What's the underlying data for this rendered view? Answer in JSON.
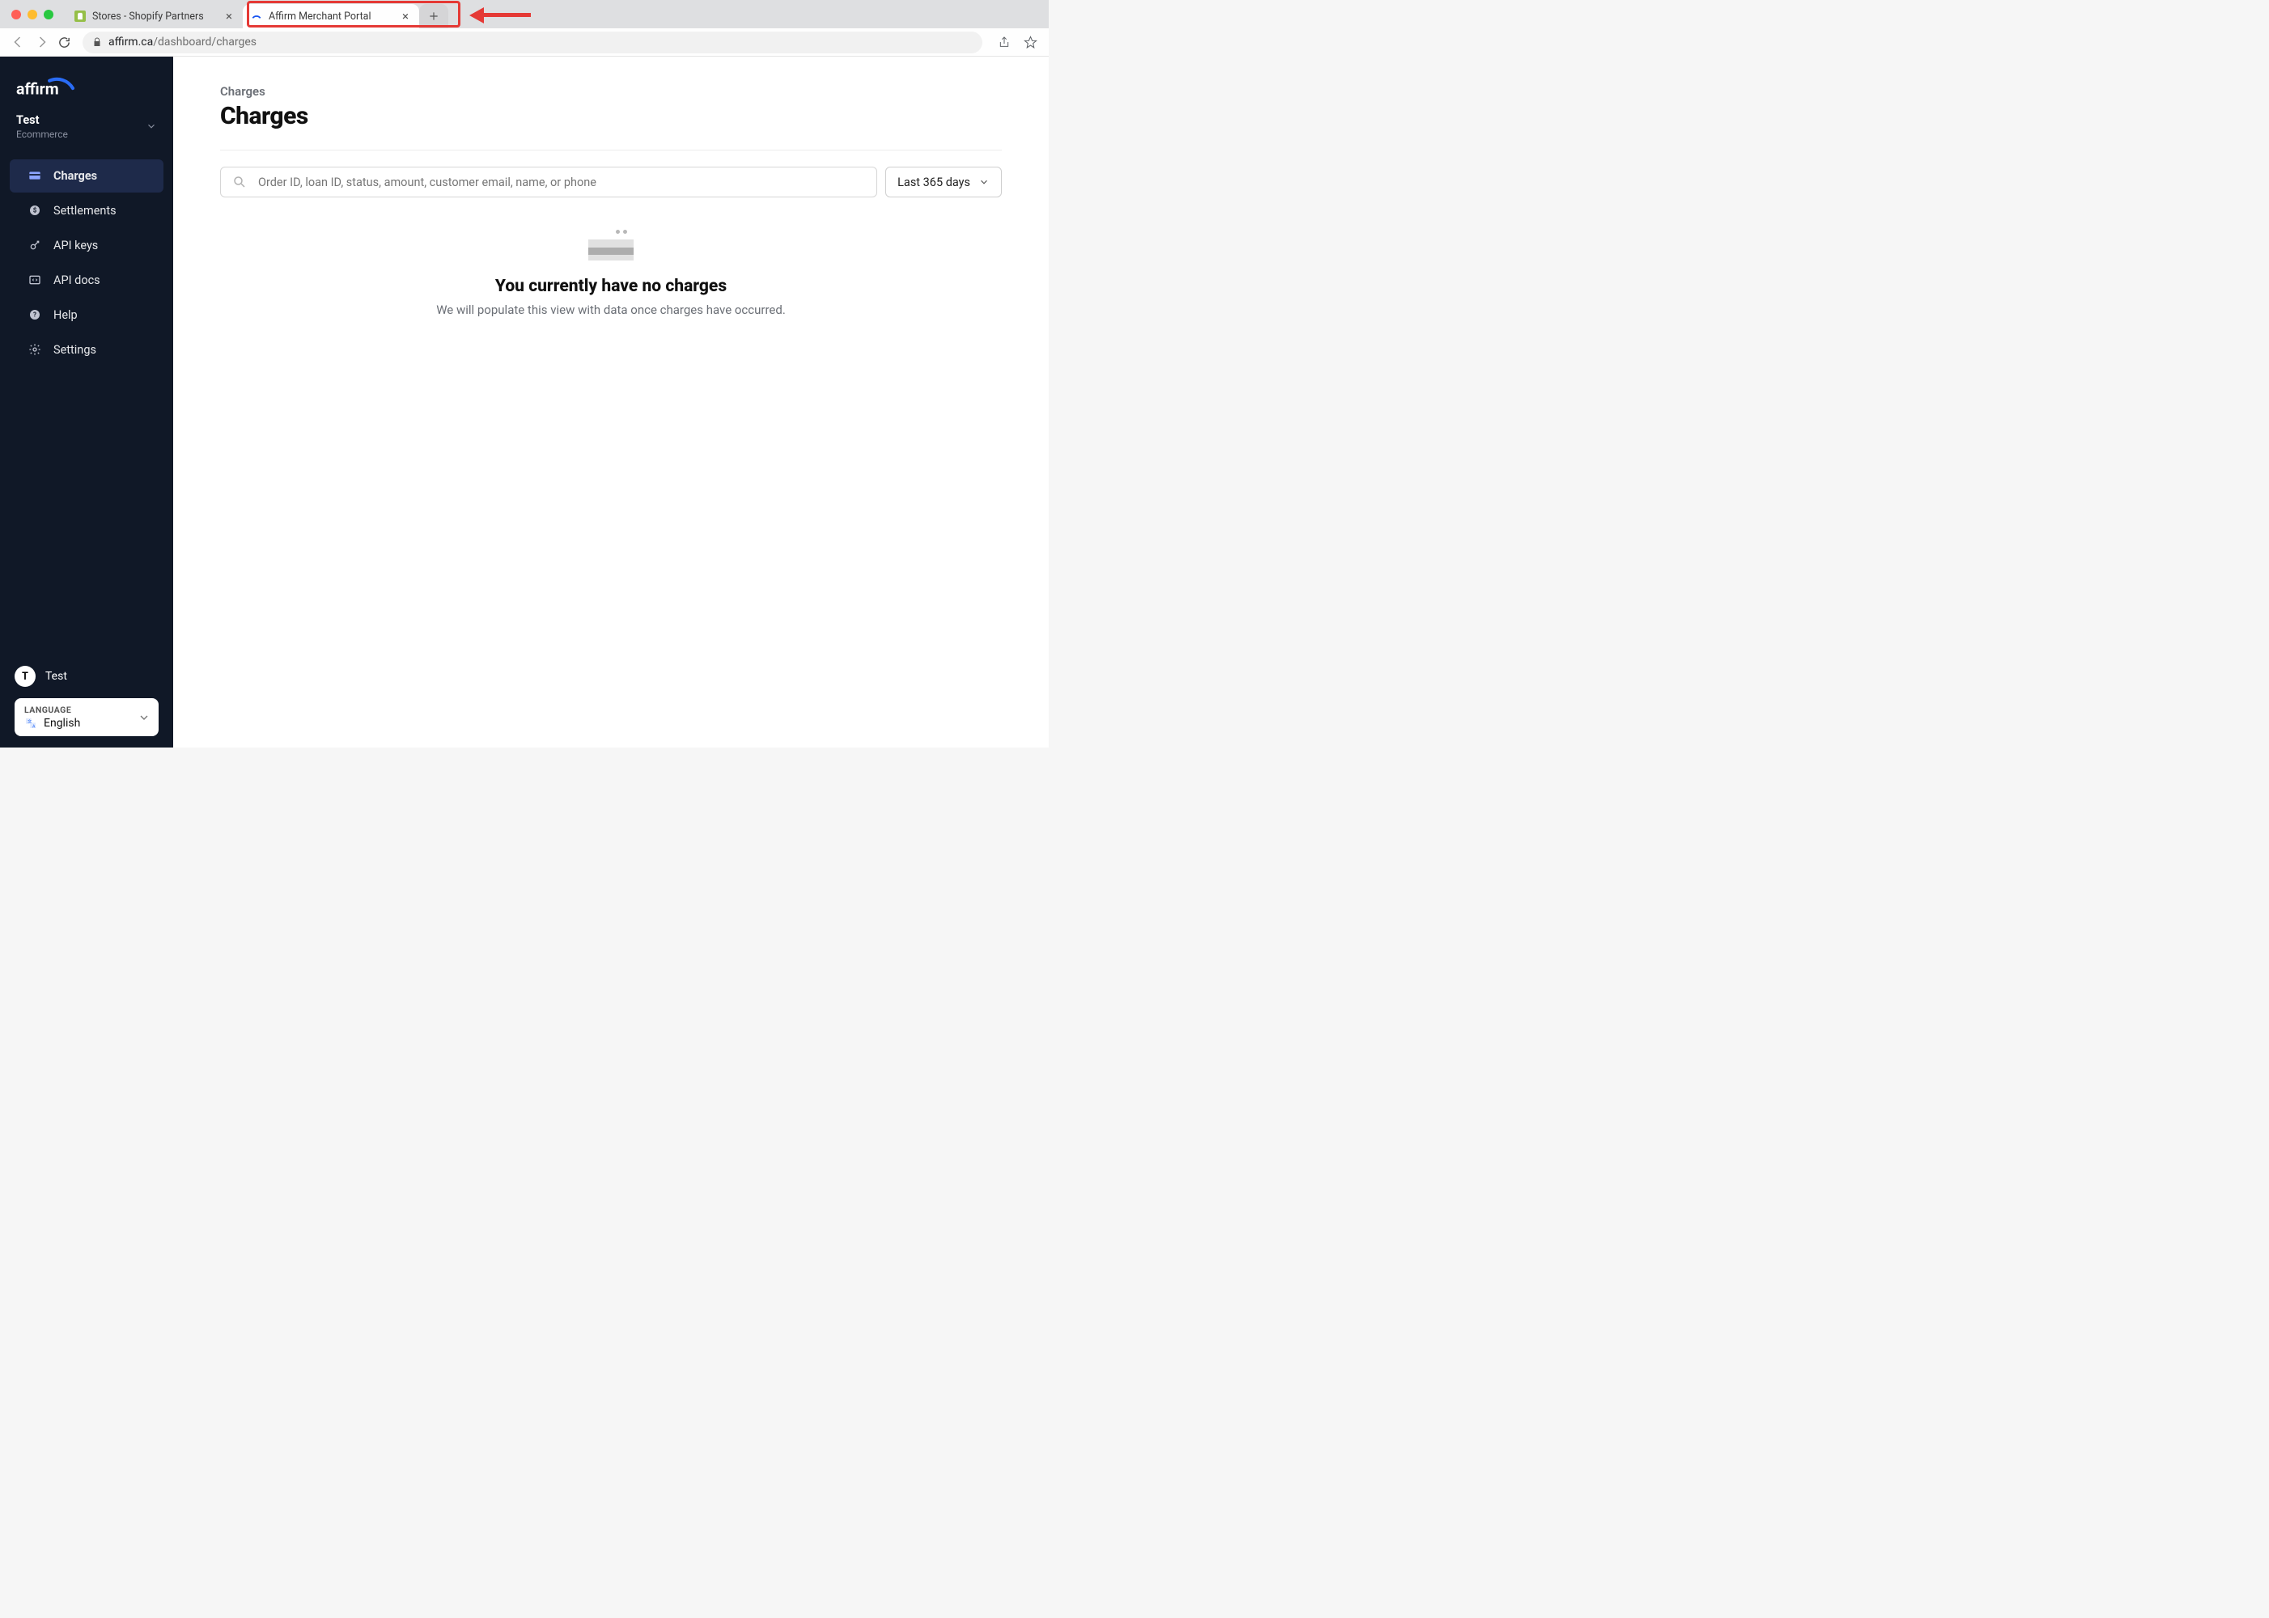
{
  "browser": {
    "tabs": [
      {
        "title": "Stores - Shopify Partners",
        "favicon_color": "#95bf47"
      },
      {
        "title": "Affirm Merchant Portal",
        "favicon_color": "#1552f0"
      }
    ],
    "url_host": "affirm.ca",
    "url_path": "/dashboard/charges"
  },
  "sidebar": {
    "merchant_name": "Test",
    "merchant_sub": "Ecommerce",
    "items": [
      {
        "label": "Charges"
      },
      {
        "label": "Settlements"
      },
      {
        "label": "API keys"
      },
      {
        "label": "API docs"
      },
      {
        "label": "Help"
      },
      {
        "label": "Settings"
      }
    ],
    "user": {
      "initial": "T",
      "name": "Test"
    },
    "language": {
      "label": "LANGUAGE",
      "value": "English"
    }
  },
  "main": {
    "breadcrumb": "Charges",
    "title": "Charges",
    "search_placeholder": "Order ID, loan ID, status, amount, customer email, name, or phone",
    "date_filter": "Last 365 days",
    "empty": {
      "heading": "You currently have no charges",
      "body": "We will populate this view with data once charges have occurred."
    }
  }
}
